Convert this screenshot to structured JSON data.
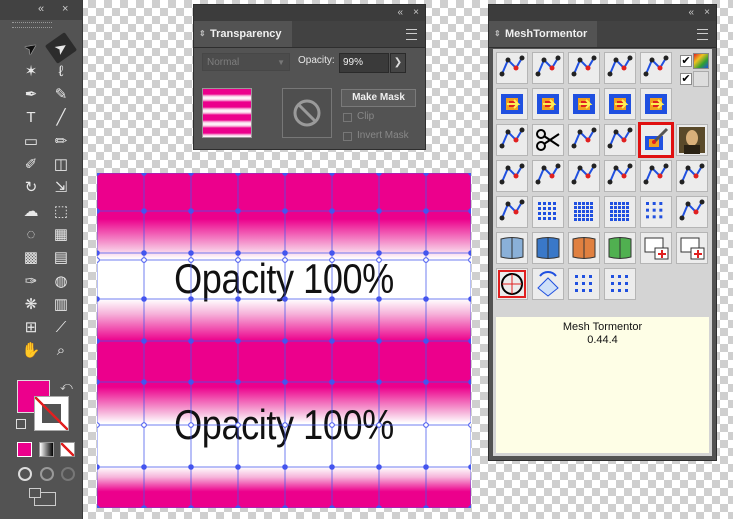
{
  "tools_panel": {
    "collapse_glyph": "«",
    "close_glyph": "×",
    "tools": [
      {
        "name": "selection-tool-icon",
        "glyph": "➤",
        "selected": false
      },
      {
        "name": "direct-selection-tool-icon",
        "glyph": "➤",
        "selected": true
      },
      {
        "name": "magic-wand-tool-icon",
        "glyph": "✶",
        "selected": false
      },
      {
        "name": "lasso-tool-icon",
        "glyph": "ℓ",
        "selected": false
      },
      {
        "name": "pen-tool-icon",
        "glyph": "✒",
        "selected": false
      },
      {
        "name": "curvature-tool-icon",
        "glyph": "✎",
        "selected": false
      },
      {
        "name": "type-tool-icon",
        "glyph": "T",
        "selected": false
      },
      {
        "name": "line-segment-tool-icon",
        "glyph": "╱",
        "selected": false
      },
      {
        "name": "rectangle-tool-icon",
        "glyph": "▭",
        "selected": false
      },
      {
        "name": "paintbrush-tool-icon",
        "glyph": "✏",
        "selected": false
      },
      {
        "name": "shaper-tool-icon",
        "glyph": "✐",
        "selected": false
      },
      {
        "name": "eraser-tool-icon",
        "glyph": "◫",
        "selected": false
      },
      {
        "name": "rotate-tool-icon",
        "glyph": "↻",
        "selected": false
      },
      {
        "name": "scale-tool-icon",
        "glyph": "⇲",
        "selected": false
      },
      {
        "name": "warp-tool-icon",
        "glyph": "☁",
        "selected": false
      },
      {
        "name": "free-transform-tool-icon",
        "glyph": "⬚",
        "selected": false
      },
      {
        "name": "shape-builder-tool-icon",
        "glyph": "◌",
        "selected": false
      },
      {
        "name": "perspective-grid-tool-icon",
        "glyph": "▦",
        "selected": false
      },
      {
        "name": "mesh-tool-icon",
        "glyph": "▩",
        "selected": false
      },
      {
        "name": "gradient-tool-icon",
        "glyph": "▤",
        "selected": false
      },
      {
        "name": "eyedropper-tool-icon",
        "glyph": "✑",
        "selected": false
      },
      {
        "name": "blend-tool-icon",
        "glyph": "◍",
        "selected": false
      },
      {
        "name": "symbol-sprayer-tool-icon",
        "glyph": "❋",
        "selected": false
      },
      {
        "name": "column-graph-tool-icon",
        "glyph": "▥",
        "selected": false
      },
      {
        "name": "artboard-tool-icon",
        "glyph": "⊞",
        "selected": false
      },
      {
        "name": "slice-tool-icon",
        "glyph": "⟋",
        "selected": false
      },
      {
        "name": "hand-tool-icon",
        "glyph": "✋",
        "selected": false
      },
      {
        "name": "zoom-tool-icon",
        "glyph": "⌕",
        "selected": false
      }
    ],
    "fill_color": "#ec008c"
  },
  "transparency_panel": {
    "collapse_glyph": "«",
    "close_glyph": "×",
    "tab_label": "Transparency",
    "blend_mode": "Normal",
    "opacity_label": "Opacity:",
    "opacity_value": "99%",
    "opacity_stepper": "❯",
    "make_mask_label": "Make Mask",
    "clip_label": "Clip",
    "invert_mask_label": "Invert Mask"
  },
  "mesh_panel": {
    "collapse_glyph": "«",
    "close_glyph": "×",
    "tab_label": "MeshTormentor",
    "info_title": "Mesh Tormentor",
    "info_version": "0.44.4",
    "checkbox_1": "✔",
    "checkbox_2": "✔"
  },
  "artwork": {
    "text_top": "Opacity 100%",
    "text_bottom": "Opacity 100%",
    "fill_color": "#ec008c",
    "mesh_color": "#4455ee"
  }
}
